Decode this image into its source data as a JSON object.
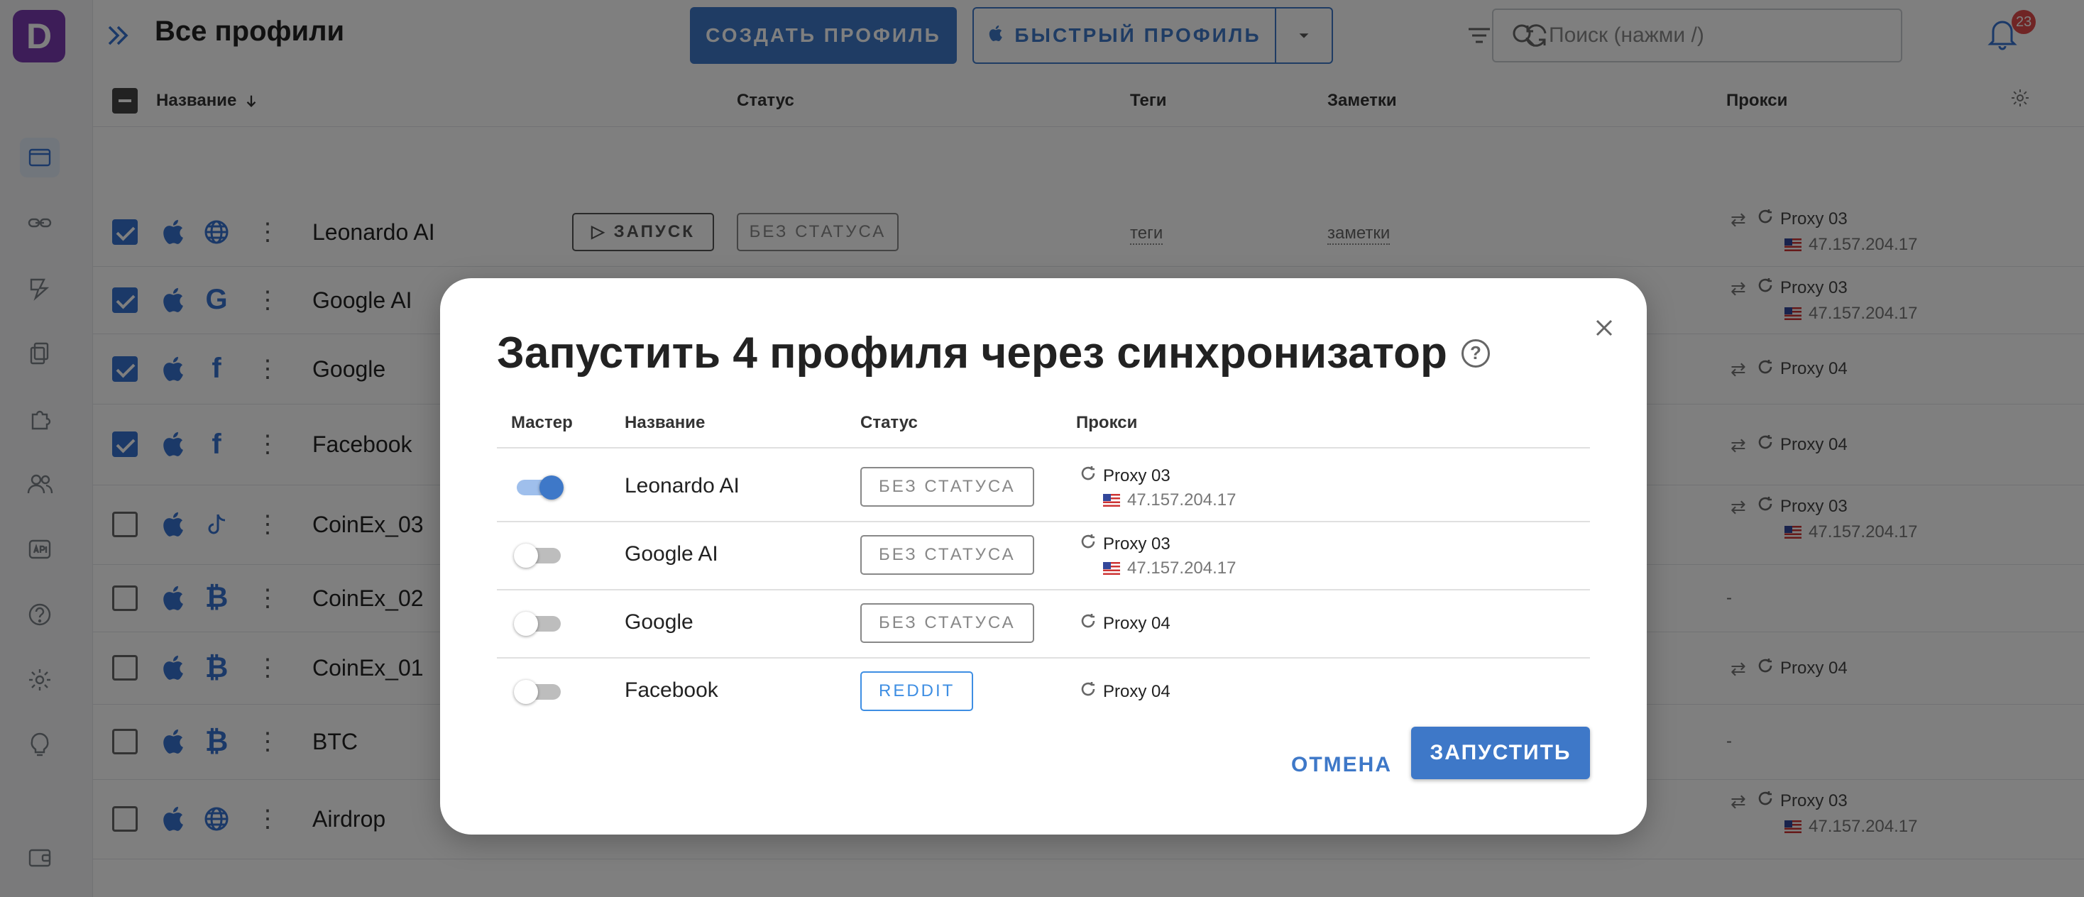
{
  "app": {
    "logo_letter": "D"
  },
  "header": {
    "title": "Все профили",
    "create_button": "СОЗДАТЬ ПРОФИЛЬ",
    "quick_button": "БЫСТРЫЙ ПРОФИЛЬ",
    "search_placeholder": "Поиск (нажми /)",
    "notification_count": "23"
  },
  "table": {
    "columns": {
      "name": "Название",
      "status": "Статус",
      "tags": "Теги",
      "notes": "Заметки",
      "proxy": "Прокси"
    },
    "run_label": "ЗАПУСК",
    "status_label": "БЕЗ СТАТУСА",
    "tags_placeholder": "теги",
    "notes_placeholder": "заметки",
    "rows": [
      {
        "name": "Leonardo AI",
        "checked": true,
        "site_icon": "globe-icon",
        "proxy": "Proxy 03",
        "ip": "47.157.204.17"
      },
      {
        "name": "Google AI",
        "checked": true,
        "site_icon": "google-icon",
        "proxy": "Proxy 03",
        "ip": "47.157.204.17"
      },
      {
        "name": "Google",
        "checked": true,
        "site_icon": "facebook-icon",
        "proxy": "Proxy 04",
        "ip": ""
      },
      {
        "name": "Facebook",
        "checked": true,
        "site_icon": "facebook-icon",
        "proxy": "Proxy 04",
        "ip": ""
      },
      {
        "name": "CoinEx_03",
        "checked": false,
        "site_icon": "tiktok-icon",
        "proxy": "Proxy 03",
        "ip": "47.157.204.17"
      },
      {
        "name": "CoinEx_02",
        "checked": false,
        "site_icon": "bitcoin-icon",
        "proxy": "-",
        "ip": ""
      },
      {
        "name": "CoinEx_01",
        "checked": false,
        "site_icon": "bitcoin-icon",
        "proxy": "Proxy 04",
        "ip": ""
      },
      {
        "name": "BTC",
        "checked": false,
        "site_icon": "bitcoin-icon",
        "proxy": "-",
        "ip": ""
      },
      {
        "name": "Airdrop",
        "checked": false,
        "site_icon": "globe-icon",
        "proxy": "Proxy 03",
        "ip": "47.157.204.17"
      }
    ]
  },
  "modal": {
    "title": "Запустить 4 профиля через синхронизатор",
    "columns": {
      "master": "Мастер",
      "name": "Название",
      "status": "Статус",
      "proxy": "Прокси"
    },
    "rows": [
      {
        "master": true,
        "name": "Leonardo AI",
        "status": "БЕЗ СТАТУСА",
        "proxy": "Proxy 03",
        "ip": "47.157.204.17"
      },
      {
        "master": false,
        "name": "Google AI",
        "status": "БЕЗ СТАТУСА",
        "proxy": "Proxy 03",
        "ip": "47.157.204.17"
      },
      {
        "master": false,
        "name": "Google",
        "status": "БЕЗ СТАТУСА",
        "proxy": "Proxy 04",
        "ip": ""
      },
      {
        "master": false,
        "name": "Facebook",
        "status": "REDDIT",
        "proxy": "Proxy 04",
        "ip": ""
      }
    ],
    "cancel_label": "ОТМЕНА",
    "launch_label": "ЗАПУСТИТЬ"
  },
  "colors": {
    "accent": "#3e78c8",
    "brand": "#7a3bb0",
    "badge": "#e14b4b",
    "reddit_tag": "#3e8ee3"
  }
}
